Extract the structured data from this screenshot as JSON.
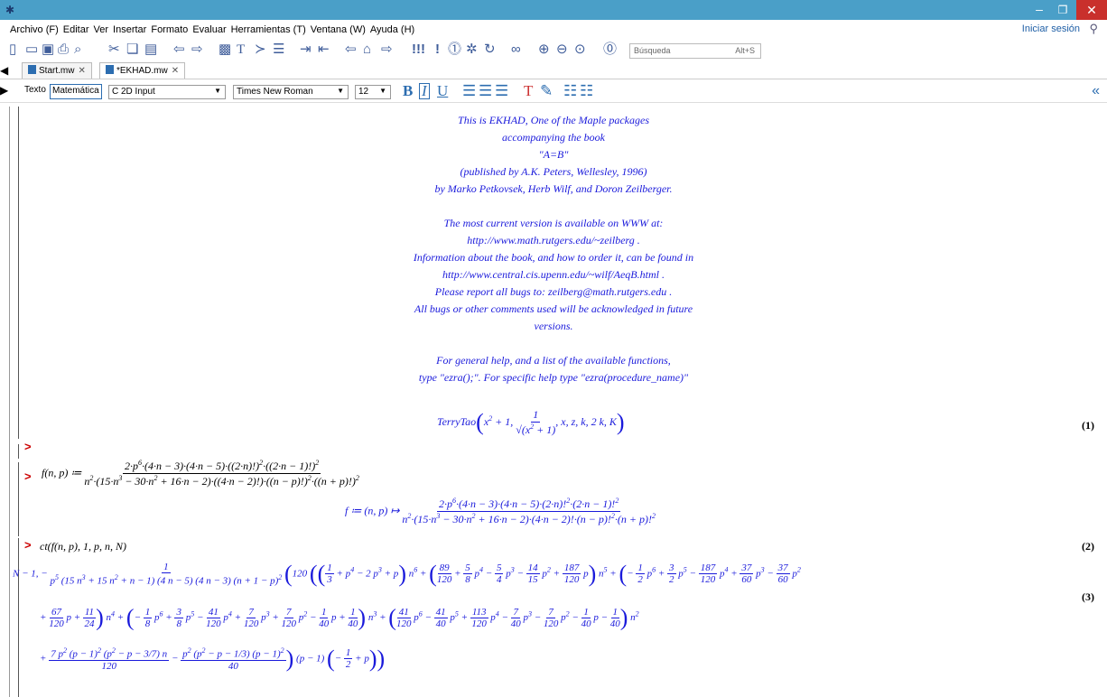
{
  "app": {
    "menu": [
      "Archivo (F)",
      "Editar",
      "Ver",
      "Insertar",
      "Formato",
      "Evaluar",
      "Herramientas (T)",
      "Ventana (W)",
      "Ayuda (H)"
    ],
    "signin": "Iniciar sesión",
    "search_placeholder": "Búsqueda",
    "search_shortcut": "Alt+S",
    "tabs": [
      "Start.mw",
      "*EKHAD.mw"
    ],
    "text_mode": "Texto",
    "math_mode": "Matemática",
    "input_mode": "2D Input",
    "font": "Times New Roman",
    "size": "12"
  },
  "doc": {
    "intro": [
      "This is EKHAD, One of the Maple packages",
      "accompanying the book",
      "\"A=B\"",
      "(published by A.K. Peters, Wellesley, 1996)",
      "by Marko Petkovsek, Herb Wilf, and Doron Zeilberger.",
      "",
      "The most current version is available on WWW at:",
      "http://www.math.rutgers.edu/~zeilberg .",
      "Information about the book, and how to order it, can be found in",
      "http://www.central.cis.upenn.edu/~wilf/AeqB.html .",
      "Please report all bugs to: zeilberg@math.rutgers.edu .",
      "All bugs or other comments used will be acknowledged in future",
      "versions.",
      "",
      "For general help, and a list of the available functions,",
      "type \"ezra();\". For specific help type \"ezra(procedure_name)\""
    ],
    "eq1": "(1)",
    "eq2": "(2)",
    "eq3": "(3)",
    "cmd3": "ct(f(n, p), 1, p, n, N)"
  }
}
